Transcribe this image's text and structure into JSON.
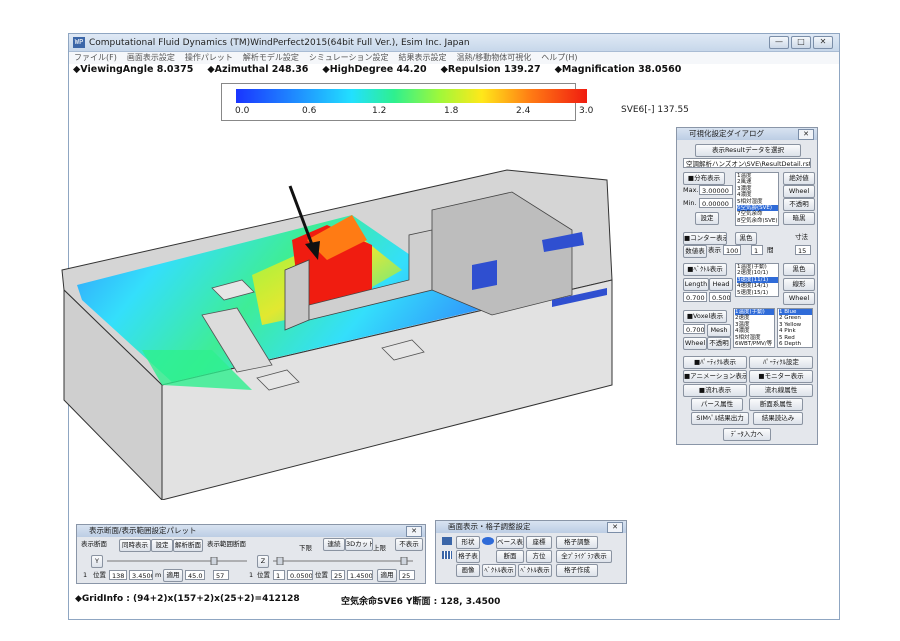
{
  "window": {
    "title": "Computational Fluid Dynamics (TM)WindPerfect2015(64bit Full Ver.), Esim Inc. Japan",
    "app_icon": "WP",
    "buttons": {
      "minimize": "—",
      "maximize": "□",
      "close": "✕"
    }
  },
  "menu": [
    "ファイル(F)",
    "画面表示設定",
    "操作パレット",
    "解析モデル設定",
    "シミュレーション設定",
    "結果表示設定",
    "温熱/移動物体可視化",
    "ヘルプ(H)"
  ],
  "status": {
    "viewing_angle": "◆ViewingAngle 8.0375",
    "azimuthal": "◆Azimuthal 248.36",
    "high_degree": "◆HighDegree 44.20",
    "repulsion": "◆Repulsion 139.27",
    "magnification": "◆Magnification 38.0560"
  },
  "legend": {
    "ticks": [
      "0.0",
      "0.6",
      "1.2",
      "1.8",
      "2.4",
      "3.0"
    ],
    "label": "SVE6[-] 137.55",
    "colors": [
      "#1a35ff",
      "#22e0ff",
      "#2ef08f",
      "#ffe81a",
      "#ff7b14",
      "#f01c10"
    ]
  },
  "viz_dialog": {
    "title": "可視化設定ダイアログ",
    "load_result": "表示Resultデータを選択",
    "file_name": "空調解析ハンズオン\\SVE\\ResultDetail.rst",
    "dist_display": "■分布表示",
    "max_label": "Max.",
    "max_value": "3.00000",
    "min_label": "Min.",
    "min_value": "0.00000",
    "set_button": "設定",
    "dist_list": [
      "1温度",
      "2風速",
      "3濃度",
      "4濃度",
      "5相対湿度",
      "6空気齢(SVE)",
      "7空気余命",
      "8空気余命(SVE)"
    ],
    "dist_selected": "6空気齢(SVE)",
    "absolute_btn": "絶対値",
    "wheel_btn": "Wheel",
    "opaque_btn": "不透明",
    "ondo_btn": "暗黒",
    "dist_scale_btn": "一変表",
    "contour": "■コンター表示",
    "black_btn": "黒色",
    "num_label": "数値表",
    "display_label": "表示",
    "contour_val1": "100",
    "contour_val2": "1",
    "interval_label": "間",
    "size_label": "寸法",
    "size_val": "15",
    "vector_display": "■ﾍﾞｸﾄﾙ表示",
    "vector_list": [
      "1温度(手動)",
      "2速度(10/1)",
      "3速度(11/1)",
      "4速度(14/1)",
      "5速度(15/1)"
    ],
    "vector_selected": "3速度(11/1)",
    "length_btn": "Length",
    "head_btn": "Head",
    "black2_btn": "黒色",
    "outline_btn": "線形",
    "len_val": "0.700",
    "head_val": "0.500",
    "wheel2_btn": "Wheel",
    "voxel_display": "■Voxel表示",
    "voxel_list": [
      "1温度(手動)",
      "2速度",
      "3温度",
      "4濃度",
      "5相対湿度",
      "6WBT/PMV/等"
    ],
    "voxel_selected": "1温度(手動)",
    "voxel_val": "0.7000",
    "mesh_btn": "Mesh",
    "wheel3_btn": "Wheel",
    "opaque2_btn": "不透明",
    "color_list": [
      "1 Blue",
      "2 Green",
      "3 Yellow",
      "4 Pink",
      "5 Red",
      "6 Depth"
    ],
    "color_selected": "1 Blue",
    "particle_display": "■ﾊﾟｰﾃｨｸﾙ表示",
    "particle_setting": "ﾊﾟｰﾃｨｸﾙ設定",
    "animation_display": "■アニメーション表示",
    "monitor_display": "■モニター表示",
    "streamline_display": "■流れ表示",
    "streamline_setting": "流れ線属性",
    "path_setting": "パース属性",
    "section_setting": "断面系属性",
    "csv_output": "SIMﾍﾟﾙ結果出力",
    "result_read": "結果読込み",
    "data_input": "ﾃﾞｰﾀ入力へ"
  },
  "cut_palette": {
    "title": "表示断面/表示範囲設定パレット",
    "display_section": "表示断面",
    "batch_display": "同時表示",
    "setting": "設定",
    "assign_section": "解析断面",
    "range_btn": "表示範囲断面",
    "down_label": "下限",
    "continuous": "連続",
    "three_d": "3Dカット",
    "up_label": "上限",
    "not_display": "不表示",
    "y_btn": "Y",
    "z_btn": "Z",
    "y_index": "1",
    "y_pos_label": "位置",
    "y_pos_count": "138",
    "y_pos_value": "3.4500",
    "apply_btn": "適用",
    "y_low": "45.0",
    "y_high": "57",
    "z_index": "1",
    "z_pos_label": "位置",
    "z_pos_count": "1",
    "z_pos_value": "0.05000",
    "z_pos2_count": "25",
    "z_pos2_value": "1.45000",
    "z_apply_btn": "適用",
    "z_high": "25",
    "unit": "m"
  },
  "display_panel": {
    "title": "画面表示・格子調整設定",
    "shape": "形状",
    "base": "ベース表",
    "coord": "座標",
    "grid_adjust": "格子調整",
    "grid_display": "格子表",
    "section": "断面",
    "direction": "方位",
    "all_pilot": "全ﾌﾟﾗｲｸﾞﾗﾌ表示",
    "image": "画像",
    "vector_display2": "ﾍﾞｸﾄﾙ表示",
    "vector_display3": "ﾍﾞｸﾄﾙ表示",
    "grid_create": "格子作成"
  },
  "bottom": {
    "grid_info": "◆GridInfo : (94+2)x(157+2)x(25+2)=412128",
    "section_info": "空気余命SVE6 Y断面 : 128,  3.4500"
  }
}
